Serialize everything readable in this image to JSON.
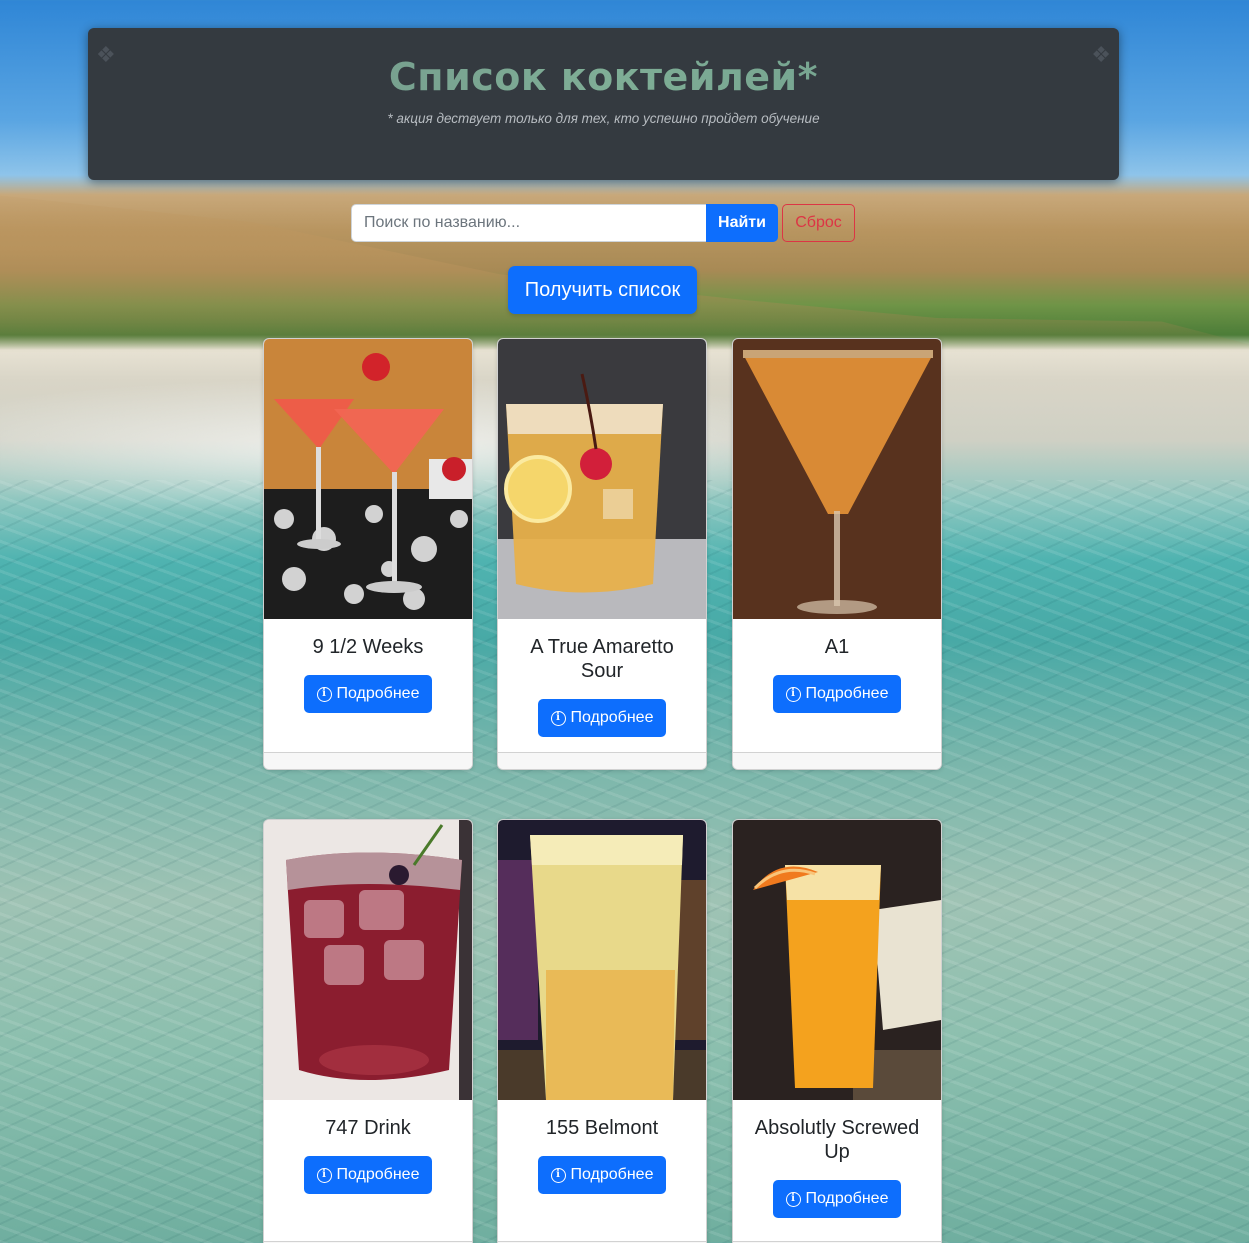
{
  "header": {
    "title": "Список коктейлей*",
    "subtitle": "* акция дествует только для тех, кто успешно пройдет обучение"
  },
  "search": {
    "placeholder": "Поиск по названию...",
    "find_label": "Найти",
    "reset_label": "Сброс"
  },
  "get_list_label": "Получить список",
  "details_label": "Подробнее",
  "cocktails": [
    {
      "name": "9 1/2 Weeks",
      "image": "red-martini-cocktail"
    },
    {
      "name": "A True Amaretto Sour",
      "image": "amaretto-sour-glass"
    },
    {
      "name": "A1",
      "image": "orange-martini-cocktail"
    },
    {
      "name": "747 Drink",
      "image": "red-drink-with-ice"
    },
    {
      "name": "155 Belmont",
      "image": "yellow-highball-drink"
    },
    {
      "name": "Absolutly Screwed Up",
      "image": "orange-juice-highball"
    }
  ]
}
